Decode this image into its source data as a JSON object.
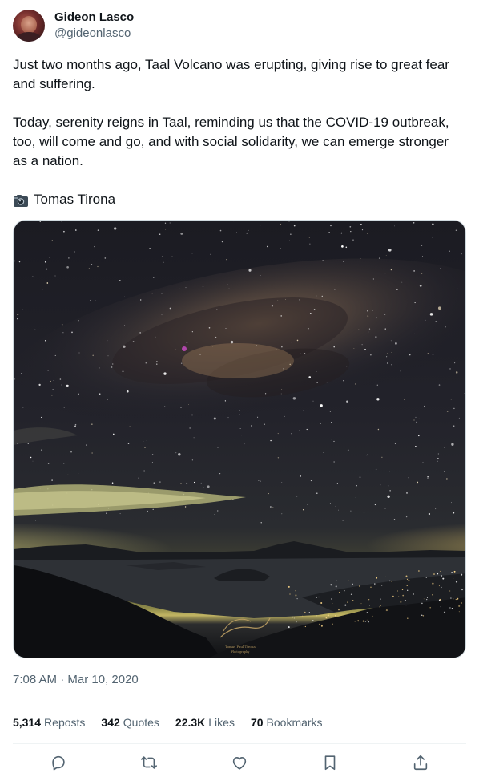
{
  "author": {
    "display_name": "Gideon Lasco",
    "handle": "@gideonlasco"
  },
  "tweet": {
    "paragraph_1": "Just two months ago, Taal Volcano was erupting, giving rise to great fear and suffering.",
    "paragraph_2": "Today, serenity reigns in Taal, reminding us that the COVID-19 outbreak, too, will come and go, and with social solidarity, we can emerge stronger as a nation.",
    "photo_credit": "Tomas Tirona",
    "photo_credit_icon": "camera-icon"
  },
  "media": {
    "watermark_line_1": "Tomas Paul Tirona",
    "watermark_line_2": "Photography"
  },
  "timestamp": {
    "time": "7:08 AM",
    "separator": "·",
    "date": "Mar 10, 2020"
  },
  "stats": {
    "reposts": {
      "count": "5,314",
      "label": "Reposts"
    },
    "quotes": {
      "count": "342",
      "label": "Quotes"
    },
    "likes": {
      "count": "22.3K",
      "label": "Likes"
    },
    "bookmarks": {
      "count": "70",
      "label": "Bookmarks"
    }
  },
  "actions": [
    "reply-icon",
    "repost-icon",
    "like-icon",
    "bookmark-icon",
    "share-icon"
  ],
  "colors": {
    "text_primary": "#0f1419",
    "text_secondary": "#536471",
    "divider": "#eff3f4"
  }
}
